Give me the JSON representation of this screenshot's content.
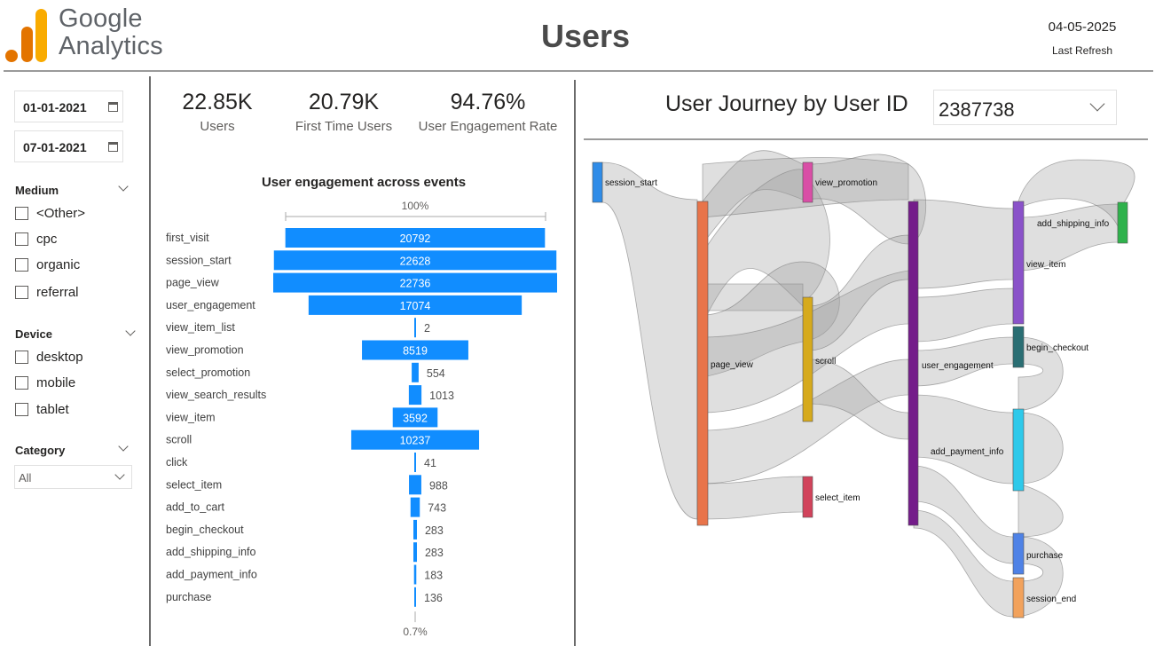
{
  "header": {
    "logo_line1": "Google",
    "logo_line2": "Analytics",
    "title": "Users",
    "date": "04-05-2025",
    "refresh_label": "Last Refresh"
  },
  "filters": {
    "start_date": "01-01-2021",
    "end_date": "07-01-2021",
    "medium": {
      "title": "Medium",
      "options": [
        "<Other>",
        "cpc",
        "organic",
        "referral"
      ]
    },
    "device": {
      "title": "Device",
      "options": [
        "desktop",
        "mobile",
        "tablet"
      ]
    },
    "category": {
      "title": "Category",
      "value": "All"
    }
  },
  "kpis": [
    {
      "value": "22.85K",
      "label": "Users"
    },
    {
      "value": "20.79K",
      "label": "First Time Users"
    },
    {
      "value": "94.76%",
      "label": "User Engagement Rate"
    }
  ],
  "chart_data": {
    "type": "bar",
    "orientation": "funnel",
    "title": "User engagement across events",
    "top_label": "100%",
    "bottom_label": "0.7%",
    "color": "#118dff",
    "categories": [
      "first_visit",
      "session_start",
      "page_view",
      "user_engagement",
      "view_item_list",
      "view_promotion",
      "select_promotion",
      "view_search_results",
      "view_item",
      "scroll",
      "click",
      "select_item",
      "add_to_cart",
      "begin_checkout",
      "add_shipping_info",
      "add_payment_info",
      "purchase"
    ],
    "values": [
      20792,
      22628,
      22736,
      17074,
      2,
      8519,
      554,
      1013,
      3592,
      10237,
      41,
      988,
      743,
      283,
      283,
      183,
      136
    ]
  },
  "journey": {
    "title": "User Journey by User ID",
    "user_id": "2387738",
    "nodes": [
      {
        "label": "session_start",
        "color": "#2f8ce8"
      },
      {
        "label": "page_view",
        "color": "#e8744a"
      },
      {
        "label": "view_promotion",
        "color": "#d94ea6"
      },
      {
        "label": "scroll",
        "color": "#d6aa1c"
      },
      {
        "label": "select_item",
        "color": "#d1435b"
      },
      {
        "label": "user_engagement",
        "color": "#741c8a"
      },
      {
        "label": "view_item",
        "color": "#8a52c9"
      },
      {
        "label": "begin_checkout",
        "color": "#2a6e73"
      },
      {
        "label": "add_payment_info",
        "color": "#2ec9ea"
      },
      {
        "label": "purchase",
        "color": "#4f82e6"
      },
      {
        "label": "session_end",
        "color": "#f2a25c"
      },
      {
        "label": "add_shipping_info",
        "color": "#2fb24c"
      }
    ]
  }
}
